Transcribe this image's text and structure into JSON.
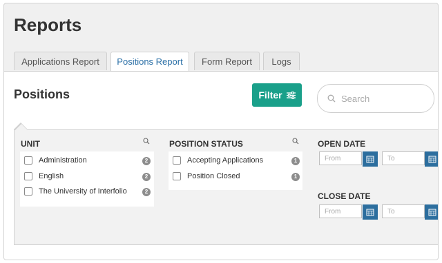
{
  "page": {
    "title": "Reports"
  },
  "tabs": [
    {
      "label": "Applications Report"
    },
    {
      "label": "Positions Report"
    },
    {
      "label": "Form Report"
    },
    {
      "label": "Logs"
    }
  ],
  "section": {
    "title": "Positions"
  },
  "filter": {
    "label": "Filter"
  },
  "search": {
    "placeholder": "Search"
  },
  "unit": {
    "title": "UNIT",
    "items": [
      {
        "label": "Administration",
        "count": "2"
      },
      {
        "label": "English",
        "count": "2"
      },
      {
        "label": "The University of Interfolio",
        "count": "2"
      }
    ]
  },
  "status": {
    "title": "POSITION STATUS",
    "items": [
      {
        "label": "Accepting Applications",
        "count": "1"
      },
      {
        "label": "Position Closed",
        "count": "1"
      }
    ]
  },
  "open_date": {
    "title": "OPEN DATE",
    "from": "From",
    "to": "To"
  },
  "close_date": {
    "title": "CLOSE DATE",
    "from": "From",
    "to": "To"
  },
  "colors": {
    "accent": "#1aa08a",
    "calendar": "#2c6e9e",
    "active_tab_text": "#2a6fa6"
  }
}
